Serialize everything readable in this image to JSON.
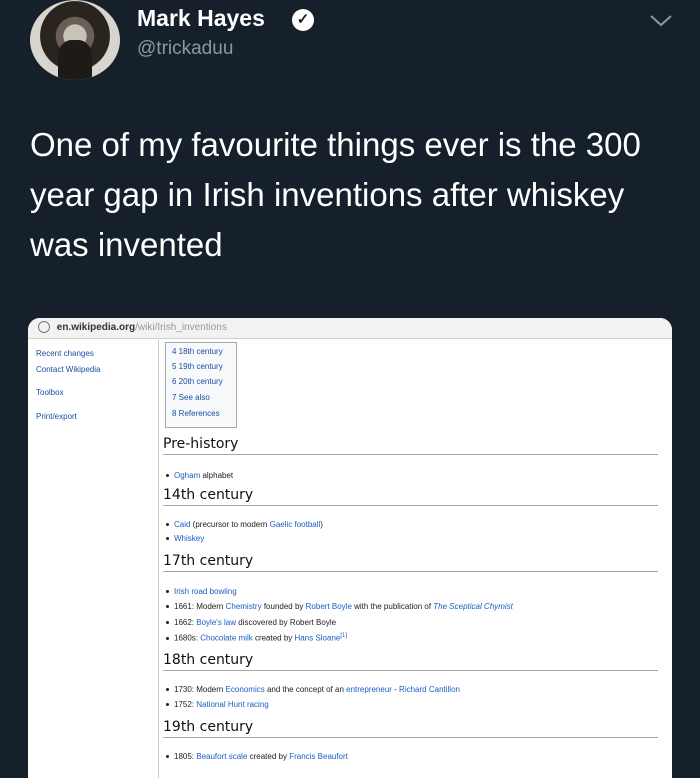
{
  "tweet": {
    "author_name": "Mark Hayes",
    "verified_glyph": "✓",
    "handle": "@trickaduu",
    "text": "One of my favourite things ever is the 300 year gap in Irish inventions after whiskey was invented"
  },
  "screenshot": {
    "url_domain": "en.wikipedia.org",
    "url_path": "/wiki/Irish_inventions",
    "sidebar": [
      "Recent changes",
      "Contact Wikipedia",
      "Toolbox",
      "Print/export"
    ],
    "toc": [
      "4 18th century",
      "5 19th century",
      "6 20th century",
      "7 See also",
      "8 References"
    ],
    "sections": [
      {
        "heading": "Pre-history"
      },
      {
        "heading": "14th century"
      },
      {
        "heading": "17th century"
      },
      {
        "heading": "18th century"
      },
      {
        "heading": "19th century"
      }
    ],
    "items": {
      "ogham_link": "Ogham",
      "ogham_rest": " alphabet",
      "caid_link": "Caid",
      "caid_mid": " (precursor to modern ",
      "caid_link2": "Gaelic football",
      "caid_end": ")",
      "whiskey": "Whiskey",
      "road_bowling": "Irish road bowling",
      "i1661_pre": "1661: Modern ",
      "i1661_link1": "Chemistry",
      "i1661_mid": " founded by ",
      "i1661_link2": "Robert Boyle",
      "i1661_mid2": " with the publication of ",
      "i1661_link3": "The Sceptical Chymist",
      "i1662_pre": "1662: ",
      "i1662_link": "Boyle's law",
      "i1662_rest": " discovered by Robert Boyle",
      "i1680_pre": "1680s: ",
      "i1680_link": "Chocolate milk",
      "i1680_mid": " created by ",
      "i1680_link2": "Hans Sloane",
      "i1680_sup": "[1]",
      "i1730_pre": "1730: Modern ",
      "i1730_link1": "Economics",
      "i1730_mid": " and the concept of an ",
      "i1730_link2": "entrepreneur",
      "i1730_dash": " - ",
      "i1730_link3": "Richard Cantillon",
      "i1752_pre": "1752: ",
      "i1752_link": "National Hunt racing",
      "i1805_pre": "1805: ",
      "i1805_link": "Beaufort scale",
      "i1805_mid": " created by ",
      "i1805_link2": "Francis Beaufort"
    }
  }
}
